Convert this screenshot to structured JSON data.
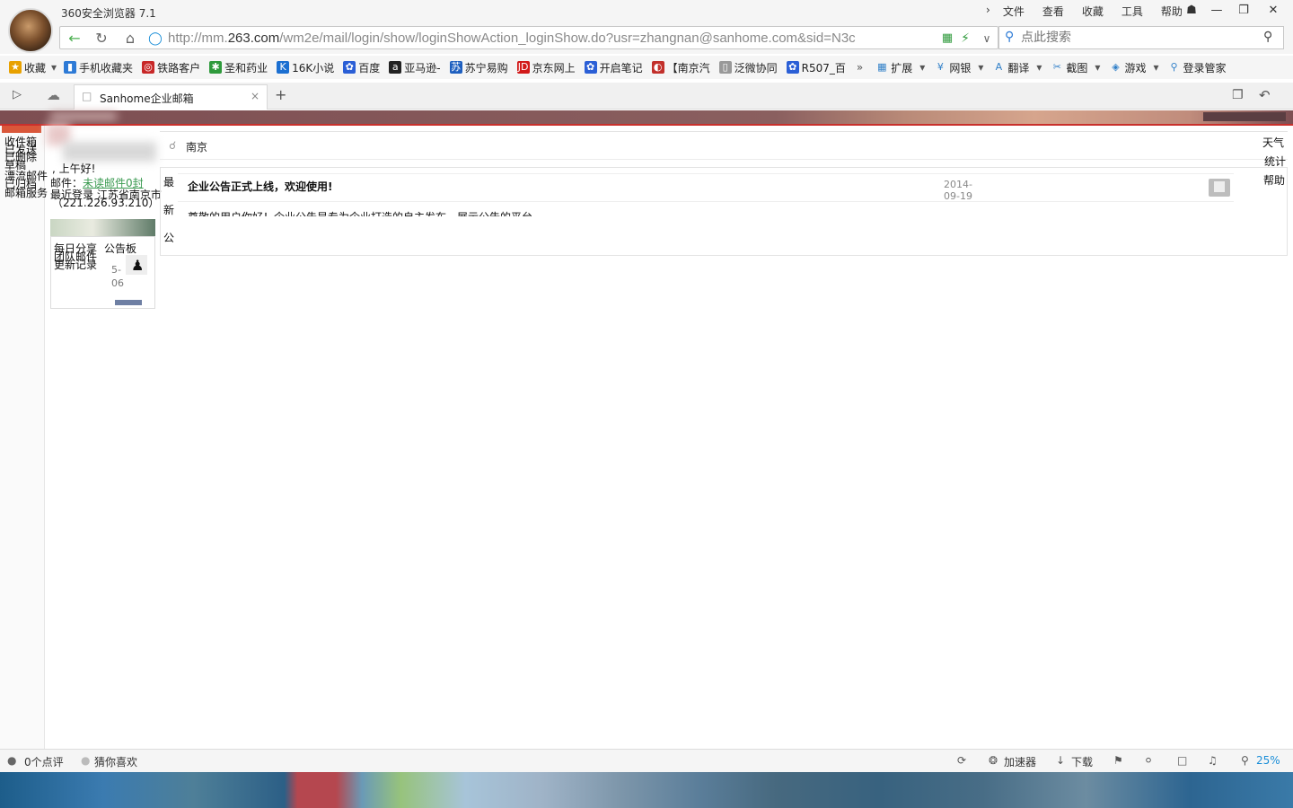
{
  "browser": {
    "title": "360安全浏览器 7.1",
    "menu": [
      "文件",
      "查看",
      "收藏",
      "工具",
      "帮助"
    ],
    "url_prefix": "http://mm.",
    "url_domain": "263.com",
    "url_path": "/wm2e/mail/login/show/loginShowAction_loginShow.do?usr=zhangnan@sanhome.com&sid=N3c",
    "search_placeholder": "点此搜索"
  },
  "bookmarks": [
    {
      "label": "收藏",
      "icon": "star-icon",
      "color": "#e8a100"
    },
    {
      "label": "手机收藏夹",
      "icon": "phone-icon",
      "color": "#2d7ad6"
    },
    {
      "label": "铁路客户",
      "icon": "railway-icon",
      "color": "#c82828"
    },
    {
      "label": "圣和药业",
      "icon": "leaf-icon",
      "color": "#2f9a3c"
    },
    {
      "label": "16K小说",
      "icon": "book-icon",
      "color": "#1b6fd1"
    },
    {
      "label": "百度",
      "icon": "paw-icon",
      "color": "#2b5fd6"
    },
    {
      "label": "亚马逊-",
      "icon": "amazon-icon",
      "color": "#222222"
    },
    {
      "label": "苏宁易购",
      "icon": "suning-icon",
      "color": "#1e5fbf"
    },
    {
      "label": "京东网上",
      "icon": "jd-icon",
      "color": "#d21a1a"
    },
    {
      "label": "开启笔记",
      "icon": "paw-icon",
      "color": "#2b5fd6"
    },
    {
      "label": "【南京汽",
      "icon": "swirl-icon",
      "color": "#c2302b"
    },
    {
      "label": "泛微协同",
      "icon": "page-icon",
      "color": "#999999"
    },
    {
      "label": "R507_百",
      "icon": "paw-icon",
      "color": "#2b5fd6"
    }
  ],
  "toolbar_right": [
    {
      "label": "扩展",
      "icon": "extension-icon"
    },
    {
      "label": "网银",
      "icon": "bank-icon"
    },
    {
      "label": "翻译",
      "icon": "translate-icon"
    },
    {
      "label": "截图",
      "icon": "screenshot-icon"
    },
    {
      "label": "游戏",
      "icon": "game-icon"
    },
    {
      "label": "登录管家",
      "icon": "login-manager-icon"
    }
  ],
  "tab": {
    "label": "Sanhome企业邮箱",
    "close": "×",
    "new": "+"
  },
  "mail": {
    "left_nav": [
      "收件箱",
      "已发送",
      "已删除",
      "草稿",
      "漂流邮件",
      "已归档",
      "邮箱服务"
    ],
    "greeting": ", 上午好!",
    "mail_label": "邮件：",
    "unread_link": "未读邮件0封",
    "ip_text": "（221.226.93.210）",
    "ip_prefix": "最近登录 江苏省南京市",
    "side_links": [
      "每日分享",
      "公告板",
      "团队邮件",
      "更新记录"
    ],
    "side_dates": [
      "5-",
      "06"
    ],
    "city": "南京",
    "right_links": [
      "天气",
      "统计",
      "帮助"
    ],
    "notice_side": [
      "最",
      "新",
      "公"
    ],
    "notice_title": "企业公告正式上线，欢迎使用!",
    "notice_date_1": "2014-",
    "notice_date_2": "09-19",
    "notice_body": "尊敬的用户你好！企业公告是专为企业打造的自主发布、展示公告的平台"
  },
  "statusbar": {
    "comments": "0个点评",
    "guess": "猜你喜欢",
    "accelerator": "加速器",
    "download": "下载",
    "zoom": "25%"
  }
}
